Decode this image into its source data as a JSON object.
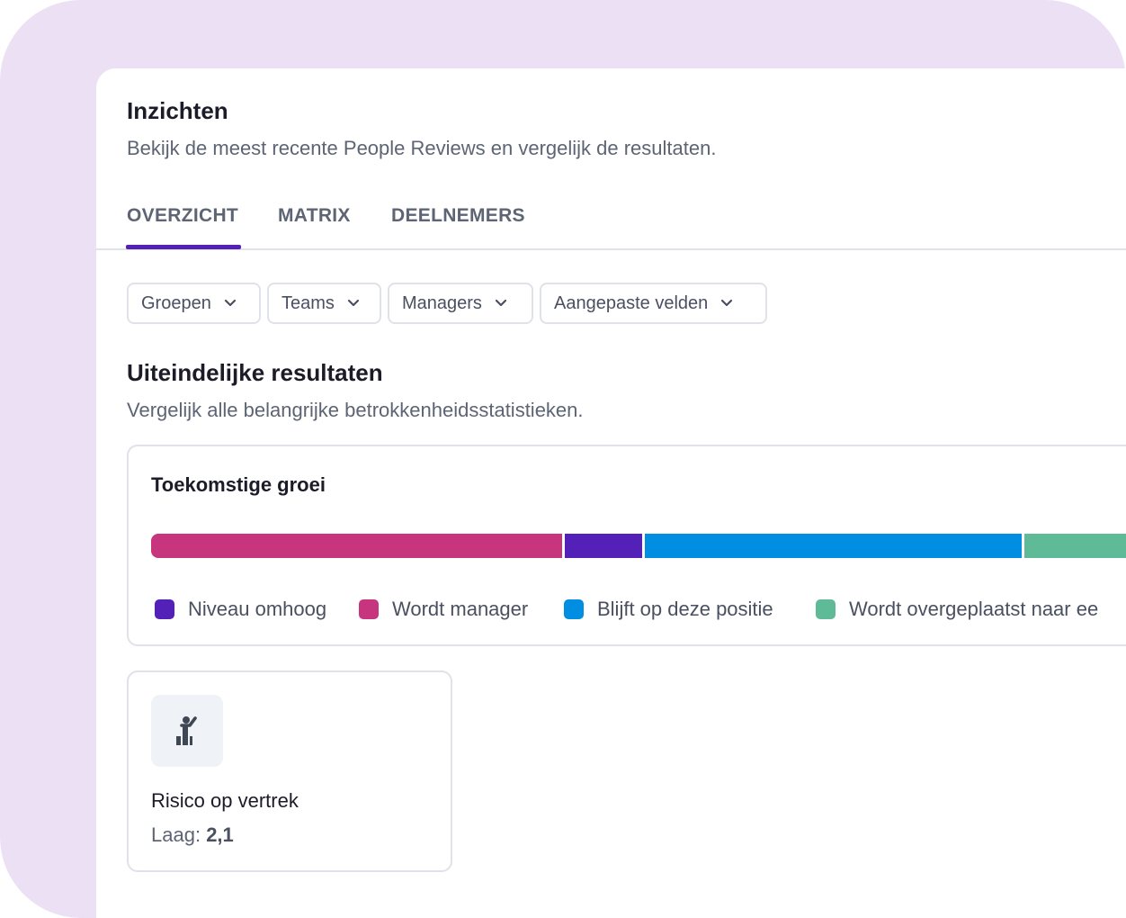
{
  "header": {
    "title": "Inzichten",
    "subtitle": "Bekijk de meest recente People Reviews en vergelijk de resultaten."
  },
  "tabs": [
    {
      "label": "OVERZICHT",
      "active": true
    },
    {
      "label": "MATRIX",
      "active": false
    },
    {
      "label": "DEELNEMERS",
      "active": false
    }
  ],
  "filters": [
    {
      "label": "Groepen"
    },
    {
      "label": "Teams"
    },
    {
      "label": "Managers"
    },
    {
      "label": "Aangepaste velden"
    }
  ],
  "section": {
    "title": "Uiteindelijke resultaten",
    "subtitle": "Vergelijk alle belangrijke betrokkenheidsstatistieken."
  },
  "growth": {
    "title": "Toekomstige groei",
    "segments": [
      {
        "name": "Wordt manager",
        "share": 0.386,
        "color": "#c6357d"
      },
      {
        "name": "Niveau omhoog",
        "share": 0.075,
        "color": "#5421b8"
      },
      {
        "name": "Blijft op deze positie",
        "share": 0.354,
        "color": "#008ee2"
      },
      {
        "name": "Wordt overgeplaatst naar ee",
        "share": 0.185,
        "color": "#5fba97"
      }
    ],
    "legend": [
      {
        "label": "Niveau omhoog",
        "color": "#5421b8"
      },
      {
        "label": "Wordt manager",
        "color": "#c6357d"
      },
      {
        "label": "Blijft op deze positie",
        "color": "#008ee2"
      },
      {
        "label": "Wordt overgeplaatst naar ee",
        "color": "#5fba97"
      }
    ]
  },
  "risk": {
    "icon": "person-waving-icon",
    "title": "Risico op vertrek",
    "label": "Laag:",
    "value": "2,1"
  }
}
